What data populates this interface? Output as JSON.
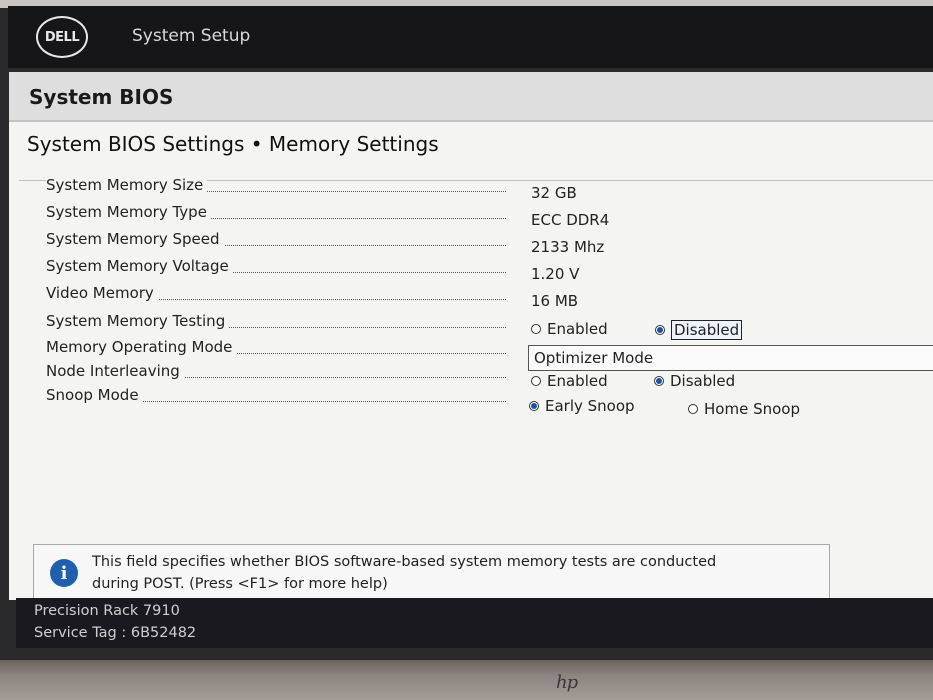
{
  "header": {
    "logo_text": "DELL",
    "app_title": "System Setup"
  },
  "panel": {
    "title": "System BIOS",
    "page_title": "System BIOS Settings • Memory Settings"
  },
  "settings": {
    "memory_size": {
      "label": "System Memory Size",
      "value": "32 GB"
    },
    "memory_type": {
      "label": "System Memory Type",
      "value": "ECC DDR4"
    },
    "memory_speed": {
      "label": "System Memory Speed",
      "value": "2133 Mhz"
    },
    "memory_voltage": {
      "label": "System Memory Voltage",
      "value": "1.20 V"
    },
    "video_memory": {
      "label": "Video Memory",
      "value": "16 MB"
    },
    "memory_testing": {
      "label": "System Memory Testing",
      "options": [
        "Enabled",
        "Disabled"
      ],
      "selected": "Disabled"
    },
    "operating_mode": {
      "label": "Memory Operating Mode",
      "value": "Optimizer Mode"
    },
    "node_interleaving": {
      "label": "Node Interleaving",
      "options": [
        "Enabled",
        "Disabled"
      ],
      "selected": "Disabled"
    },
    "snoop_mode": {
      "label": "Snoop Mode",
      "options": [
        "Early Snoop",
        "Home Snoop"
      ],
      "selected": "Early Snoop"
    }
  },
  "help": {
    "icon": "info-icon",
    "text_line1": "This field specifies whether BIOS software-based system memory tests are conducted",
    "text_line2": "during POST. (Press <F1> for more help)"
  },
  "footer": {
    "model": "Precision Rack 7910",
    "service_tag": "Service Tag : 6B52482"
  },
  "bezel": {
    "brand": "hp"
  },
  "colors": {
    "header_bg": "#161619",
    "panel_bg": "#f4f4f2",
    "accent": "#1f5fae"
  }
}
